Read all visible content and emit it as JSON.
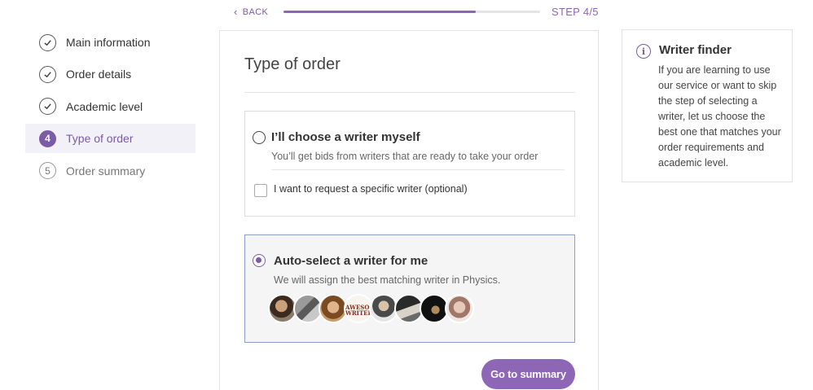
{
  "nav": {
    "back_label": "BACK",
    "step_label": "STEP 4/5",
    "progress": 0.75
  },
  "steps": [
    {
      "label": "Main information",
      "state": "done"
    },
    {
      "label": "Order details",
      "state": "done"
    },
    {
      "label": "Academic level",
      "state": "done"
    },
    {
      "label": "Type of order",
      "number": "4",
      "state": "active"
    },
    {
      "label": "Order summary",
      "number": "5",
      "state": "pending"
    }
  ],
  "main": {
    "title": "Type of order",
    "option_self": {
      "title": "I’ll choose a writer myself",
      "subtitle": "You’ll get bids from writers that are ready to take your order",
      "checkbox_label": "I want to request a specific writer (optional)",
      "selected": false
    },
    "option_auto": {
      "title": "Auto-select a writer for me",
      "subtitle": "We will assign the best matching writer in Physics.",
      "selected": true,
      "avatar_logo_text": "AWESOME WRITER"
    },
    "submit_label": "Go to summary"
  },
  "info": {
    "title": "Writer finder",
    "text": "If you are learning to use our service or want to skip the step of selecting a writer, let us choose the best one that matches your order requirements and academic level."
  },
  "colors": {
    "accent": "#8d67b6",
    "active_bg": "#f3f1f8",
    "selected_option_border": "#8b9fc4"
  }
}
